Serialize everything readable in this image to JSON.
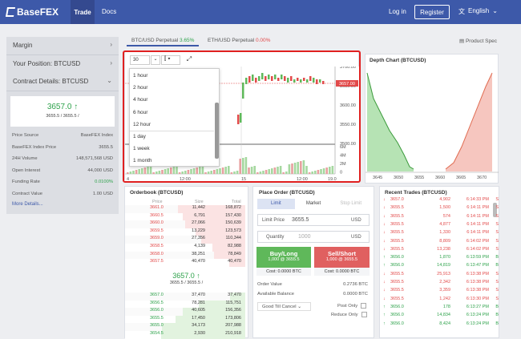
{
  "topbar": {
    "brand": "BaseFEX",
    "nav_trade": "Trade",
    "nav_docs": "Docs",
    "login": "Log in",
    "register": "Register",
    "language": "English"
  },
  "sidebar": {
    "margin": "Margin",
    "position": "Your Position: BTCUSD",
    "contract": "Contract Details: BTCUSD",
    "price": "3657.0",
    "price_sub": "3655.5 / 3655.5 / ",
    "details": [
      [
        "Price Source",
        "BaseFEX Index"
      ],
      [
        "BaseFEX Index Price",
        "3655.5"
      ],
      [
        "24H Volume",
        "148,571,568 USD"
      ],
      [
        "Open Interest",
        "44,000 USD"
      ],
      [
        "Funding Rate",
        "0.0100%"
      ],
      [
        "Contract Value",
        "1.00 USD"
      ]
    ],
    "more": "More Details..."
  },
  "tabs": {
    "btc": "BTC/USD Perpetual",
    "btc_pct": "3.65%",
    "eth": "ETH/USD Perpetual",
    "eth_pct": "0.00%",
    "product_spec": "Product Spec"
  },
  "chart": {
    "interval": "30",
    "options": [
      "1 hour",
      "2 hour",
      "4 hour",
      "6 hour",
      "12 hour",
      "1 day",
      "1 week",
      "1 month"
    ],
    "y_labels": [
      "3700.00",
      "3650.00",
      "3600.00",
      "3550.00",
      "3500.00"
    ],
    "price_tag": "3657.00",
    "vol_labels": [
      "6M",
      "4M",
      "2M",
      "0"
    ],
    "x_labels": [
      "4",
      "12:00",
      "15",
      "12:00",
      "19.0"
    ]
  },
  "depth": {
    "title": "Depth Chart (BTCUSD)",
    "x_labels": [
      "3645",
      "3650",
      "3655",
      "3660",
      "3665",
      "3670"
    ]
  },
  "orderbook": {
    "title": "Orderbook (BTCUSD)",
    "headers": [
      "Price",
      "Size",
      "Total"
    ],
    "asks": [
      [
        "3661.0",
        "11,442",
        "168,872"
      ],
      [
        "3660.5",
        "6,791",
        "157,430"
      ],
      [
        "3660.0",
        "27,066",
        "150,639"
      ],
      [
        "3659.5",
        "13,229",
        "123,573"
      ],
      [
        "3659.0",
        "27,356",
        "110,344"
      ],
      [
        "3658.5",
        "4,139",
        "82,988"
      ],
      [
        "3658.0",
        "38,251",
        "78,849"
      ],
      [
        "3657.5",
        "40,470",
        "40,470"
      ]
    ],
    "mid": "3657.0",
    "mid_sub": "3655.5 / 3655.5 / ",
    "bids": [
      [
        "3657.0",
        "37,470",
        "37,470"
      ],
      [
        "3656.5",
        "78,281",
        "115,751"
      ],
      [
        "3656.0",
        "40,605",
        "156,356"
      ],
      [
        "3655.5",
        "17,450",
        "173,806"
      ],
      [
        "3655.0",
        "34,173",
        "207,988"
      ],
      [
        "3654.5",
        "2,930",
        "210,918"
      ]
    ]
  },
  "order": {
    "title": "Place Order (BTCUSD)",
    "tab_limit": "Limit",
    "tab_market": "Market",
    "tab_stop": "Stop Limit",
    "price_label": "Limit Price",
    "price_value": "3655.5",
    "unit": "USD",
    "qty_label": "Quantity",
    "qty_value": "1000",
    "buy": "Buy/Long",
    "buy_sub": "1,000 @ 3655.5",
    "sell": "Sell/Short",
    "sell_sub": "1,000 @ 3655.5",
    "cost_buy": "Cost: 0.0000 BTC",
    "cost_sell": "Cost: 0.0000 BTC",
    "order_value_label": "Order Value",
    "order_value": "0.2736 BTC",
    "balance_label": "Available Balance",
    "balance": "0.0000 BTC",
    "tif": "Good Till Cancel",
    "post_only": "Post Only",
    "reduce_only": "Reduce Only"
  },
  "trades": {
    "title": "Recent Trades (BTCUSD)",
    "rows": [
      [
        "down",
        "3657.0",
        "4,902",
        "6:14:33 PM",
        "S"
      ],
      [
        "down",
        "3655.5",
        "1,500",
        "6:14:11 PM",
        "S"
      ],
      [
        "down",
        "3655.5",
        "574",
        "6:14:11 PM",
        "S"
      ],
      [
        "down",
        "3655.5",
        "4,877",
        "6:14:11 PM",
        "S"
      ],
      [
        "down",
        "3655.5",
        "1,330",
        "6:14:11 PM",
        "S"
      ],
      [
        "down",
        "3655.5",
        "8,809",
        "6:14:02 PM",
        "S"
      ],
      [
        "down",
        "3655.5",
        "13,238",
        "6:14:02 PM",
        "S"
      ],
      [
        "up",
        "3656.0",
        "1,870",
        "6:13:59 PM",
        "B"
      ],
      [
        "up",
        "3656.0",
        "14,819",
        "6:13:47 PM",
        "B"
      ],
      [
        "down",
        "3655.5",
        "25,913",
        "6:13:38 PM",
        "S"
      ],
      [
        "down",
        "3655.5",
        "2,342",
        "6:13:38 PM",
        "S"
      ],
      [
        "down",
        "3655.5",
        "3,359",
        "6:13:38 PM",
        "S"
      ],
      [
        "down",
        "3655.5",
        "1,242",
        "6:13:30 PM",
        "S"
      ],
      [
        "up",
        "3656.0",
        "178",
        "6:13:27 PM",
        "B"
      ],
      [
        "up",
        "3656.0",
        "14,834",
        "6:13:24 PM",
        "B"
      ],
      [
        "up",
        "3656.0",
        "8,424",
        "6:13:24 PM",
        "B"
      ]
    ]
  }
}
